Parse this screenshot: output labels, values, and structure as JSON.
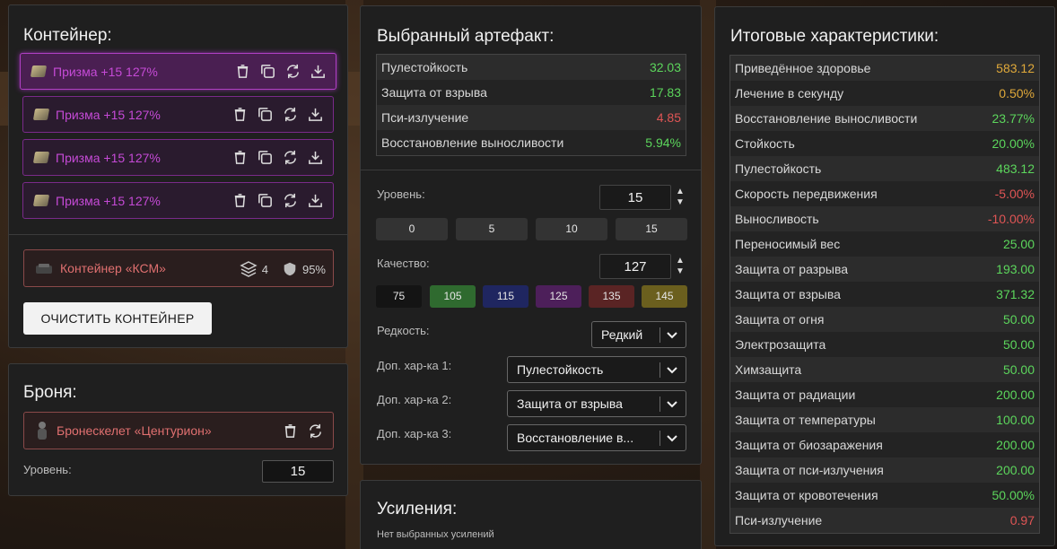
{
  "container": {
    "title": "Контейнер:",
    "artifacts": [
      {
        "name": "Призма +15 127%"
      },
      {
        "name": "Призма +15 127%"
      },
      {
        "name": "Призма +15 127%"
      },
      {
        "name": "Призма +15 127%"
      }
    ],
    "ksm": {
      "name": "Контейнер «КСМ»",
      "slots": "4",
      "efficiency": "95%"
    },
    "clear_label": "ОЧИСТИТЬ КОНТЕЙНЕР"
  },
  "armor": {
    "title": "Броня:",
    "name": "Бронескелет «Центурион»",
    "level_label": "Уровень:",
    "level_value": "15"
  },
  "artifact": {
    "title": "Выбранный артефакт:",
    "stats": [
      {
        "label": "Пулестойкость",
        "value": "32.03",
        "tone": "good"
      },
      {
        "label": "Защита от взрыва",
        "value": "17.83",
        "tone": "good"
      },
      {
        "label": "Пси-излучение",
        "value": "4.85",
        "tone": "bad"
      },
      {
        "label": "Восстановление выносливости",
        "value": "5.94%",
        "tone": "good"
      }
    ],
    "level_label": "Уровень:",
    "level_value": "15",
    "level_presets": [
      "0",
      "5",
      "10",
      "15"
    ],
    "quality_label": "Качество:",
    "quality_value": "127",
    "quality_presets": [
      {
        "label": "75",
        "color": "#141414"
      },
      {
        "label": "105",
        "color": "#2f6a2f"
      },
      {
        "label": "115",
        "color": "#1f2660"
      },
      {
        "label": "125",
        "color": "#4d1f5a"
      },
      {
        "label": "135",
        "color": "#5a2424"
      },
      {
        "label": "145",
        "color": "#6b5f1e"
      }
    ],
    "rarity_label": "Редкость:",
    "rarity_value": "Редкий",
    "extra1_label": "Доп. хар-ка 1:",
    "extra1_value": "Пулестойкость",
    "extra2_label": "Доп. хар-ка 2:",
    "extra2_value": "Защита от взрыва",
    "extra3_label": "Доп. хар-ка 3:",
    "extra3_value": "Восстановление в..."
  },
  "boosts": {
    "title": "Усиления:",
    "empty_text": "Нет выбранных усилений"
  },
  "totals": {
    "title": "Итоговые характеристики:",
    "stats": [
      {
        "label": "Приведённое здоровье",
        "value": "583.12",
        "tone": "warn"
      },
      {
        "label": "Лечение в секунду",
        "value": "0.50%",
        "tone": "warn"
      },
      {
        "label": "Восстановление выносливости",
        "value": "23.77%",
        "tone": "good"
      },
      {
        "label": "Стойкость",
        "value": "20.00%",
        "tone": "good"
      },
      {
        "label": "Пулестойкость",
        "value": "483.12",
        "tone": "good"
      },
      {
        "label": "Скорость передвижения",
        "value": "-5.00%",
        "tone": "bad"
      },
      {
        "label": "Выносливость",
        "value": "-10.00%",
        "tone": "bad"
      },
      {
        "label": "Переносимый вес",
        "value": "25.00",
        "tone": "good"
      },
      {
        "label": "Защита от разрыва",
        "value": "193.00",
        "tone": "good"
      },
      {
        "label": "Защита от взрыва",
        "value": "371.32",
        "tone": "good"
      },
      {
        "label": "Защита от огня",
        "value": "50.00",
        "tone": "good"
      },
      {
        "label": "Электрозащита",
        "value": "50.00",
        "tone": "good"
      },
      {
        "label": "Химзащита",
        "value": "50.00",
        "tone": "good"
      },
      {
        "label": "Защита от радиации",
        "value": "200.00",
        "tone": "good"
      },
      {
        "label": "Защита от температуры",
        "value": "100.00",
        "tone": "good"
      },
      {
        "label": "Защита от биозаражения",
        "value": "200.00",
        "tone": "good"
      },
      {
        "label": "Защита от пси-излучения",
        "value": "200.00",
        "tone": "good"
      },
      {
        "label": "Защита от кровотечения",
        "value": "50.00%",
        "tone": "good"
      },
      {
        "label": "Пси-излучение",
        "value": "0.97",
        "tone": "bad"
      }
    ]
  }
}
